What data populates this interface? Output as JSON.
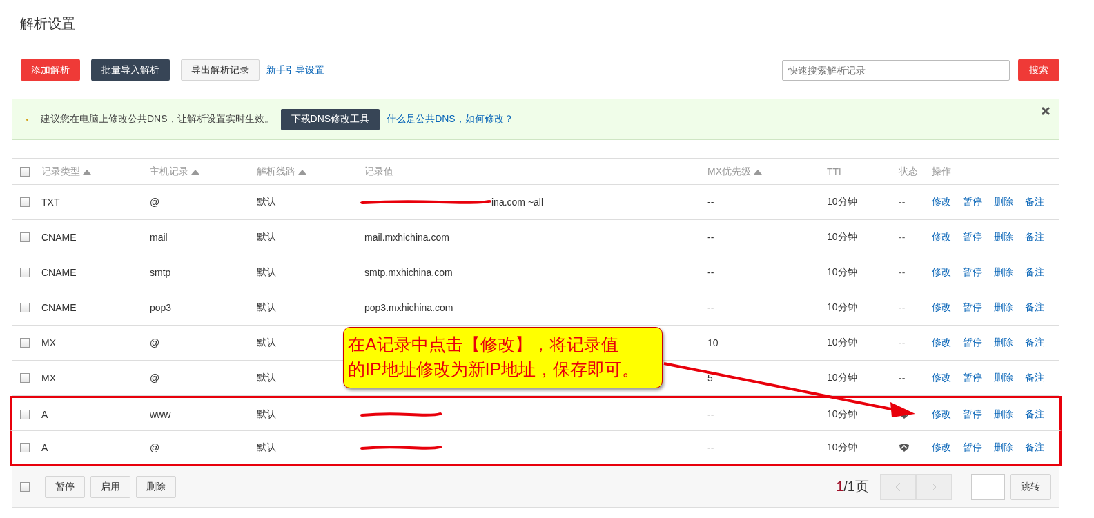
{
  "title": "解析设置",
  "toolbar": {
    "buttons": [
      {
        "label": "添加解析",
        "kind": "danger"
      },
      {
        "label": "批量导入解析",
        "kind": "dark"
      },
      {
        "label": "导出解析记录",
        "kind": "plain"
      }
    ],
    "link": "新手引导设置",
    "search": {
      "placeholder": "快速搜索解析记录",
      "button": "搜索"
    }
  },
  "notice": {
    "text": "建议您在电脑上修改公共DNS，让解析设置实时生效。",
    "button": "下载DNS修改工具",
    "link": "什么是公共DNS，如何修改？"
  },
  "table": {
    "select_all_checked": false,
    "columns": [
      {
        "label": "记录类型",
        "sortable": true
      },
      {
        "label": "主机记录",
        "sortable": true
      },
      {
        "label": "解析线路",
        "sortable": true
      },
      {
        "label": "记录值",
        "sortable": false
      },
      {
        "label": "MX优先级",
        "sortable": true
      },
      {
        "label": "TTL",
        "sortable": false
      },
      {
        "label": "状态",
        "sortable": false
      },
      {
        "label": "操作",
        "sortable": false
      }
    ],
    "rows": [
      {
        "checked": false,
        "type": "TXT",
        "host": "@",
        "line": "默认",
        "value": "ina.com ~all",
        "redacted": true,
        "mx": "--",
        "ttl": "10分钟",
        "status": {
          "kind": "text",
          "text": "--"
        },
        "actions": [
          "修改",
          "暂停",
          "删除",
          "备注"
        ],
        "highlighted": false
      },
      {
        "checked": false,
        "type": "CNAME",
        "host": "mail",
        "line": "默认",
        "value": "mail.mxhichina.com",
        "redacted": false,
        "mx": "--",
        "ttl": "10分钟",
        "status": {
          "kind": "text",
          "text": "--"
        },
        "actions": [
          "修改",
          "暂停",
          "删除",
          "备注"
        ],
        "highlighted": false
      },
      {
        "checked": false,
        "type": "CNAME",
        "host": "smtp",
        "line": "默认",
        "value": "smtp.mxhichina.com",
        "redacted": false,
        "mx": "--",
        "ttl": "10分钟",
        "status": {
          "kind": "text",
          "text": "--"
        },
        "actions": [
          "修改",
          "暂停",
          "删除",
          "备注"
        ],
        "highlighted": false
      },
      {
        "checked": false,
        "type": "CNAME",
        "host": "pop3",
        "line": "默认",
        "value": "pop3.mxhichina.com",
        "redacted": false,
        "mx": "--",
        "ttl": "10分钟",
        "status": {
          "kind": "text",
          "text": "--"
        },
        "actions": [
          "修改",
          "暂停",
          "删除",
          "备注"
        ],
        "highlighted": false
      },
      {
        "checked": false,
        "type": "MX",
        "host": "@",
        "line": "默认",
        "redacted": false,
        "mx": "10",
        "ttl": "10分钟",
        "status": {
          "kind": "text",
          "text": "--"
        },
        "actions": [
          "修改",
          "暂停",
          "删除",
          "备注"
        ],
        "highlighted": false
      },
      {
        "checked": false,
        "type": "MX",
        "host": "@",
        "line": "默认",
        "redacted": false,
        "mx": "5",
        "ttl": "10分钟",
        "status": {
          "kind": "text",
          "text": "--"
        },
        "actions": [
          "修改",
          "暂停",
          "删除",
          "备注"
        ],
        "highlighted": false
      },
      {
        "checked": false,
        "type": "A",
        "host": "www",
        "line": "默认",
        "redacted": true,
        "mx": "--",
        "ttl": "10分钟",
        "status": {
          "kind": "shield"
        },
        "actions": [
          "修改",
          "暂停",
          "删除",
          "备注"
        ],
        "highlighted": true
      },
      {
        "checked": false,
        "type": "A",
        "host": "@",
        "line": "默认",
        "redacted": true,
        "mx": "--",
        "ttl": "10分钟",
        "status": {
          "kind": "shield"
        },
        "actions": [
          "修改",
          "暂停",
          "删除",
          "备注"
        ],
        "highlighted": true
      }
    ]
  },
  "footer": {
    "checked": false,
    "buttons": [
      "暂停",
      "启用",
      "删除"
    ],
    "page_current": "1",
    "page_total": "/1页",
    "jump": "跳转"
  },
  "callout": {
    "lines": [
      "在A记录中点击【修改】，将记录值",
      "的IP地址修改为新IP地址，保存即可。"
    ]
  }
}
